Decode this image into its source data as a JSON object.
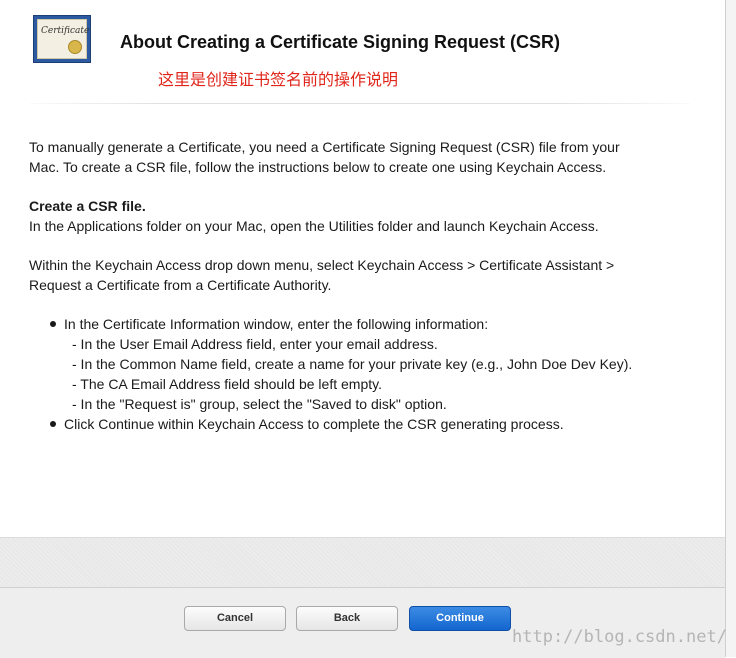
{
  "header": {
    "title": "About Creating a Certificate Signing Request (CSR)",
    "annotation": "这里是创建证书签名前的操作说明",
    "icon": "certificate-icon",
    "icon_text": "Certificate"
  },
  "content": {
    "intro_line1": "To manually generate a Certificate, you need a Certificate Signing Request (CSR) file from your",
    "intro_line2": "Mac. To create a CSR file, follow the instructions below to create one using Keychain Access.",
    "section_heading": "Create a CSR file.",
    "section_body": "In the Applications folder on your Mac, open the Utilities folder and launch Keychain Access.",
    "menu_line1": "Within the Keychain Access drop down menu, select Keychain Access > Certificate Assistant >",
    "menu_line2": "Request a Certificate from a Certificate Authority.",
    "bullets": [
      {
        "text": "In the Certificate Information window, enter the following information:",
        "subitems": [
          "- In the User Email Address field, enter your email address.",
          "- In the Common Name field, create a name for your private key (e.g., John Doe Dev Key).",
          "- The CA Email Address field should be left empty.",
          "- In the \"Request is\" group, select the \"Saved to disk\" option."
        ]
      },
      {
        "text": "Click Continue within Keychain Access to complete the CSR generating process.",
        "subitems": []
      }
    ]
  },
  "footer": {
    "cancel_label": "Cancel",
    "back_label": "Back",
    "continue_label": "Continue"
  },
  "watermark": "http://blog.csdn.net/",
  "colors": {
    "annotation": "#e0261b",
    "primary_button": "#1466cf"
  }
}
